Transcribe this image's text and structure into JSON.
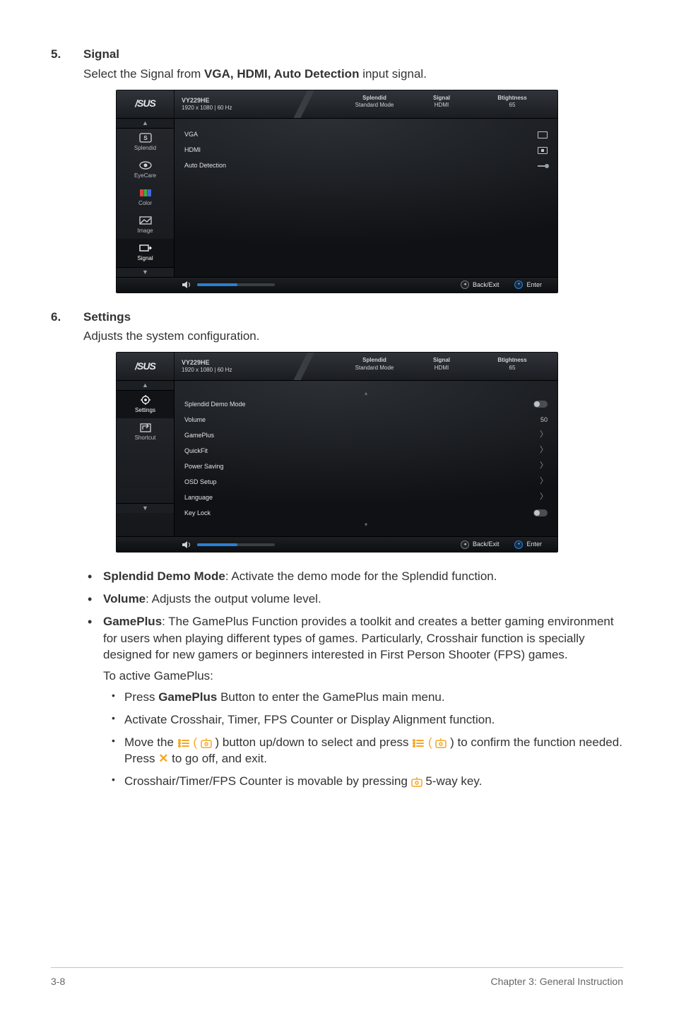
{
  "section5": {
    "num": "5.",
    "title": "Signal",
    "subtitle_pre": "Select the Signal from ",
    "subtitle_bold": "VGA, HDMI, Auto Detection",
    "subtitle_post": " input signal."
  },
  "section6": {
    "num": "6.",
    "title": "Settings",
    "subtitle": "Adjusts the system configuration."
  },
  "osd_common": {
    "logo": "/SUS",
    "model_line1": "VY229HE",
    "model_line2": "1920 x 1080  |  60 Hz",
    "stat1_label": "Splendid",
    "stat1_value": "Standard Mode",
    "stat2_label": "Signal",
    "stat2_value": "HDMI",
    "stat3_label": "Btightness",
    "stat3_value": "65",
    "back_exit": "Back/Exit",
    "enter": "Enter",
    "scroll_up": "▲",
    "scroll_down": "▼"
  },
  "osd_signal": {
    "side": [
      {
        "label": "Splendid",
        "icon": "splendid-icon"
      },
      {
        "label": "EyeCare",
        "icon": "eyecare-icon"
      },
      {
        "label": "Color",
        "icon": "color-icon"
      },
      {
        "label": "Image",
        "icon": "image-icon"
      },
      {
        "label": "Signal",
        "icon": "signal-icon",
        "selected": true
      }
    ],
    "rows": [
      {
        "label": "VGA",
        "icon": "vga"
      },
      {
        "label": "HDMI",
        "icon": "hdmi"
      },
      {
        "label": "Auto Detection",
        "icon": "auto"
      }
    ]
  },
  "osd_settings": {
    "side": [
      {
        "label": "Settings",
        "icon": "settings-icon",
        "selected": true
      },
      {
        "label": "Shortcut",
        "icon": "shortcut-icon"
      }
    ],
    "rows": [
      {
        "label": "Splendid Demo Mode",
        "kind": "toggle"
      },
      {
        "label": "Volume",
        "kind": "value",
        "value": "50"
      },
      {
        "label": "GamePlus",
        "kind": "arrow"
      },
      {
        "label": "QuickFit",
        "kind": "arrow"
      },
      {
        "label": "Power Saving",
        "kind": "arrow"
      },
      {
        "label": "OSD Setup",
        "kind": "arrow"
      },
      {
        "label": "Language",
        "kind": "arrow"
      },
      {
        "label": "Key Lock",
        "kind": "toggle"
      }
    ]
  },
  "bullets": {
    "b1_bold": "Splendid Demo Mode",
    "b1_text": ": Activate the demo mode for the Splendid function.",
    "b2_bold": "Volume",
    "b2_text": ": Adjusts the output volume level.",
    "b3_bold": "GamePlus",
    "b3_text": ": The GamePlus Function provides a toolkit and creates a better gaming environment for users when playing different types of games. Particularly, Crosshair function is specially designed for new gamers or beginners interested in First Person Shooter (FPS) games.",
    "b3_sub_intro": "To active GamePlus:",
    "s1_pre": "Press ",
    "s1_bold": "GamePlus",
    "s1_post": " Button to enter the GamePlus main menu.",
    "s2": "Activate Crosshair, Timer, FPS Counter or Display Alignment function.",
    "s3_pre": "Move the ",
    "s3_mid1": " ) button up/down to select and press ",
    "s3_mid2": " ) to confirm the function needed. Press ",
    "s3_x": "✕",
    "s3_post": " to go off, and exit.",
    "s4_pre": "Crosshair/Timer/FPS Counter is movable by pressing ",
    "s4_post": "  5-way key."
  },
  "footer": {
    "left": "3-8",
    "right": "Chapter 3: General Instruction"
  }
}
